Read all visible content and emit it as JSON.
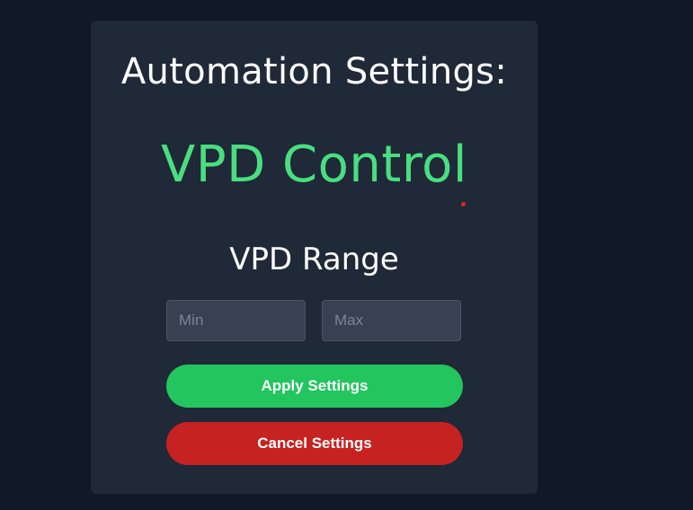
{
  "panel": {
    "title": "Automation Settings:",
    "mode": "VPD Control",
    "range_label": "VPD Range"
  },
  "inputs": {
    "min": {
      "placeholder": "Min",
      "value": ""
    },
    "max": {
      "placeholder": "Max",
      "value": ""
    }
  },
  "buttons": {
    "apply_label": "Apply Settings",
    "cancel_label": "Cancel Settings"
  },
  "colors": {
    "page_background": "#111827",
    "card_background": "#1f2937",
    "mode_text": "#4ade80",
    "apply_button": "#22c55e",
    "cancel_button": "#c62222",
    "indicator_dot": "#dc2626"
  }
}
